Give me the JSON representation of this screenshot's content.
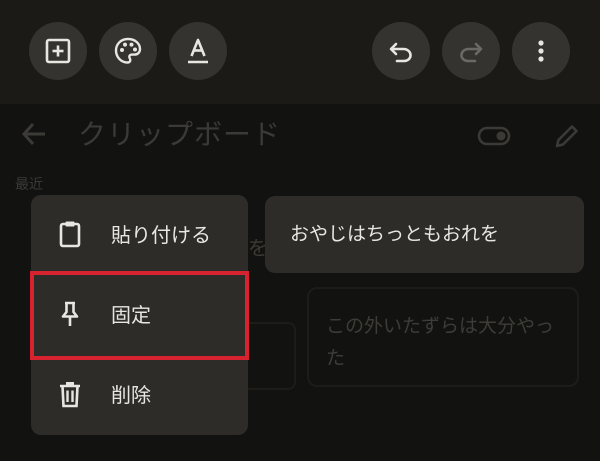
{
  "toolbar": {
    "buttons": [
      {
        "name": "add-button",
        "icon": "plus-square-icon"
      },
      {
        "name": "palette-button",
        "icon": "palette-icon"
      },
      {
        "name": "text-format-button",
        "icon": "text-format-icon"
      },
      {
        "name": "undo-button",
        "icon": "undo-icon"
      },
      {
        "name": "redo-button",
        "icon": "redo-icon"
      },
      {
        "name": "more-button",
        "icon": "more-vert-icon"
      }
    ]
  },
  "background": {
    "title": "クリップボード",
    "section_label": "最近",
    "peek_char": "を",
    "clip_text": "この外いたずらは大分やった"
  },
  "context_menu": {
    "items": [
      {
        "label": "貼り付ける",
        "icon": "clipboard-icon"
      },
      {
        "label": "固定",
        "icon": "pin-icon",
        "highlighted": true
      },
      {
        "label": "削除",
        "icon": "trash-icon"
      }
    ]
  },
  "selected_clip": {
    "text": "おやじはちっともおれを"
  },
  "colors": {
    "toolbar_bg": "#1b1a17",
    "button_bg": "#34332f",
    "menu_bg": "#2d2c29",
    "text": "#e8e6e0",
    "highlight": "#d6232f"
  }
}
